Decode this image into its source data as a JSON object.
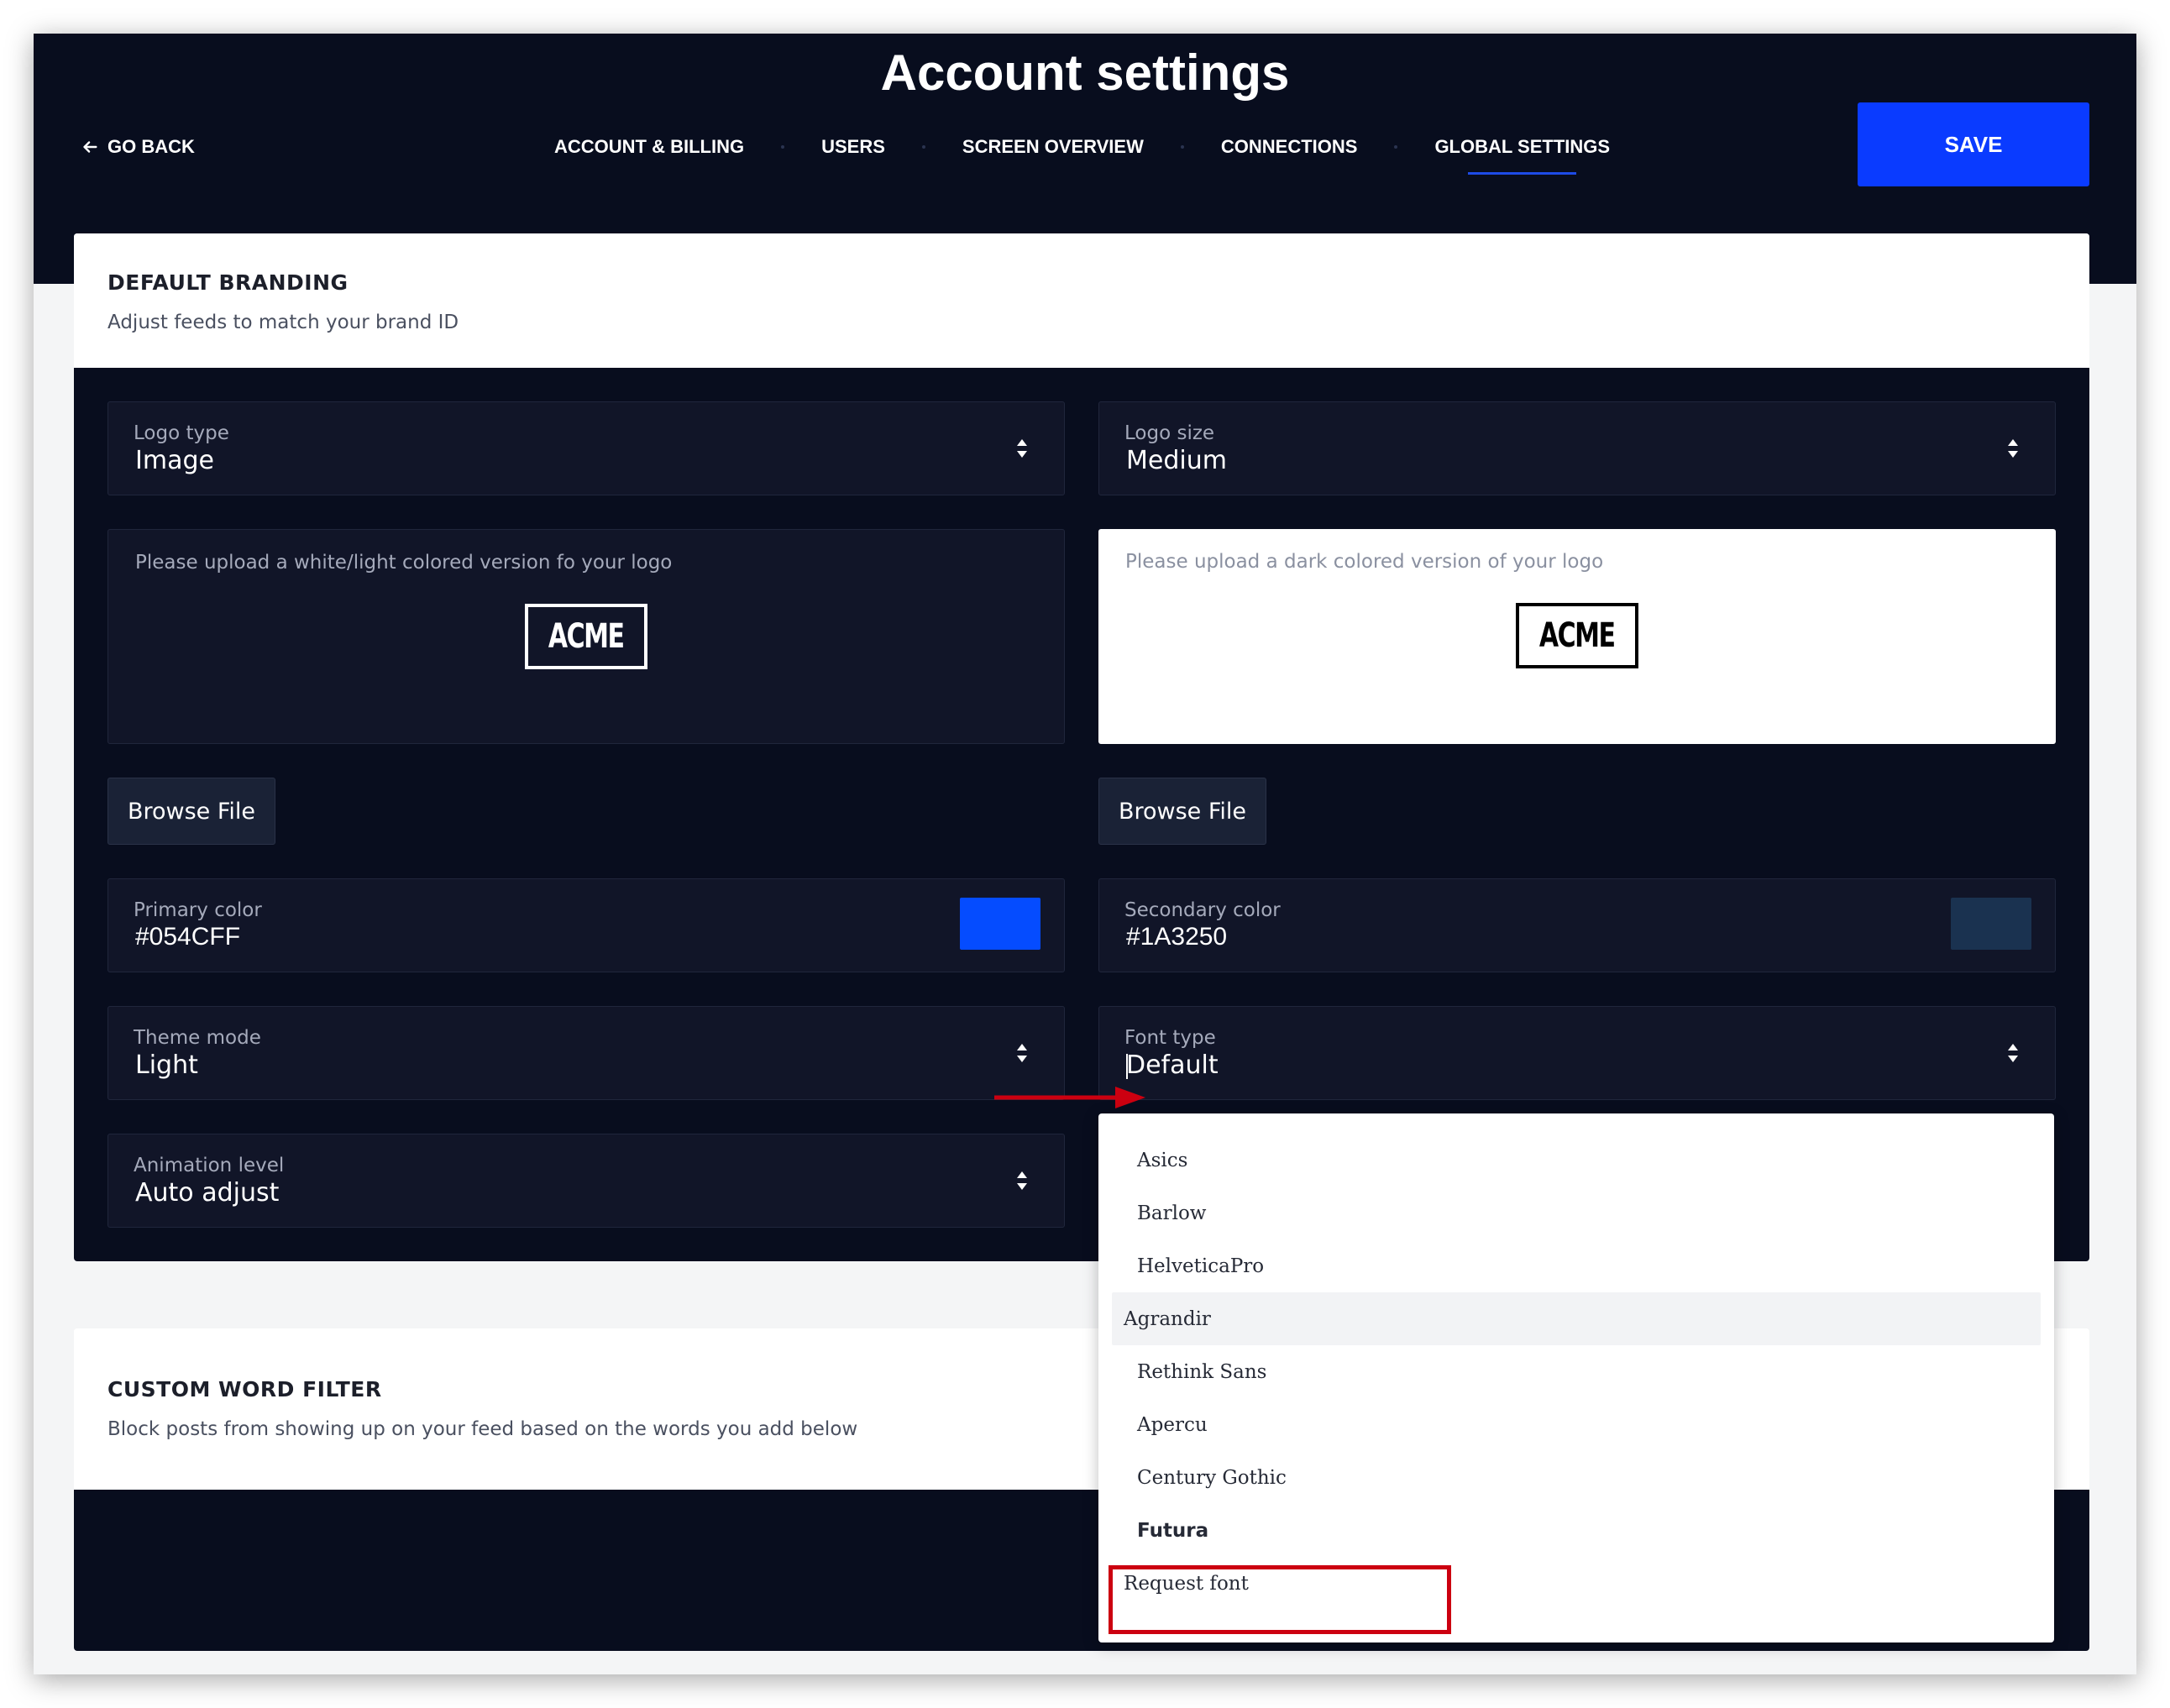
{
  "header": {
    "title": "Account settings",
    "go_back": "GO BACK",
    "save": "SAVE",
    "tabs": [
      {
        "label": "ACCOUNT & BILLING",
        "active": false
      },
      {
        "label": "USERS",
        "active": false
      },
      {
        "label": "SCREEN OVERVIEW",
        "active": false
      },
      {
        "label": "CONNECTIONS",
        "active": false
      },
      {
        "label": "GLOBAL SETTINGS",
        "active": true
      }
    ]
  },
  "branding": {
    "title": "DEFAULT BRANDING",
    "subtitle": "Adjust feeds to match your brand ID",
    "logo_type": {
      "label": "Logo type",
      "value": "Image"
    },
    "logo_size": {
      "label": "Logo size",
      "value": "Medium"
    },
    "upload_light": {
      "text": "Please upload a white/light colored version fo your logo",
      "logo": "ACME"
    },
    "upload_dark": {
      "text": "Please upload a dark colored version of your logo",
      "logo": "ACME"
    },
    "browse_label": "Browse File",
    "primary_color": {
      "label": "Primary color",
      "value": "#054CFF",
      "swatch": "#054CFF"
    },
    "secondary_color": {
      "label": "Secondary color",
      "value": "#1A3250",
      "swatch": "#1A3250"
    },
    "theme_mode": {
      "label": "Theme mode",
      "value": "Light"
    },
    "font_type": {
      "label": "Font type",
      "value": "Default"
    },
    "animation_level": {
      "label": "Animation level",
      "value": "Auto adjust"
    }
  },
  "font_dropdown": {
    "options": [
      "Asics",
      "Barlow",
      "HelveticaPro",
      "Agrandir",
      "Rethink Sans",
      "Apercu",
      "Century Gothic",
      "Futura",
      "Request font"
    ],
    "hovered": "Agrandir",
    "highlighted": "Request font"
  },
  "word_filter": {
    "title": "CUSTOM WORD FILTER",
    "subtitle": "Block posts from showing up on your feed based on the words you add below"
  },
  "colors": {
    "header_bg": "#080D1E",
    "accent": "#0A3BFF",
    "annotation_red": "#CC0010"
  }
}
